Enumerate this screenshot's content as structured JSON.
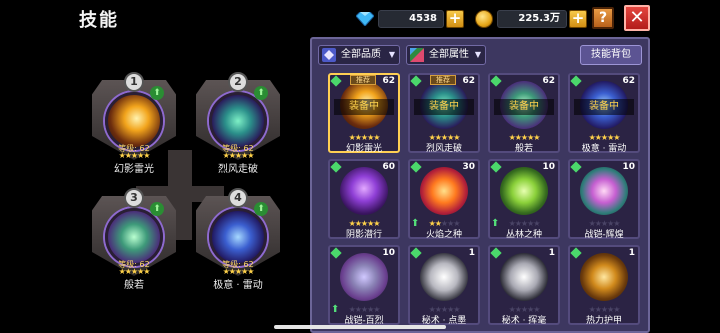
{
  "header": {
    "title": "技能"
  },
  "currency": {
    "gems": {
      "value": "4538",
      "icon": "diamond-icon"
    },
    "coins": {
      "value": "225.3万",
      "icon": "coin-icon"
    }
  },
  "buttons": {
    "help": "?",
    "close": "✕",
    "plus": "+"
  },
  "equipped": [
    {
      "slot": "1",
      "level": "等级: 62",
      "stars": "★★★★★",
      "name": "幻影雷光",
      "icon": "phantom-thunder-icon"
    },
    {
      "slot": "2",
      "level": "等级: 62",
      "stars": "★★★★★",
      "name": "烈风走破",
      "icon": "gale-break-icon"
    },
    {
      "slot": "3",
      "level": "等级: 62",
      "stars": "★★★★★",
      "name": "般若",
      "icon": "prajna-icon"
    },
    {
      "slot": "4",
      "level": "等级: 62",
      "stars": "★★★★★",
      "name": "极意 · 雷动",
      "icon": "ultimate-thunder-icon"
    }
  ],
  "panel": {
    "filter_quality": "全部品质",
    "filter_attribute": "全部属性",
    "skill_bag": "技能背包"
  },
  "cards": [
    {
      "name": "幻影雷光",
      "count": "62",
      "tag": "推荐",
      "status": "装备中",
      "stars_on": "★★★★★",
      "stars_off": "",
      "upgrade": "",
      "selected": true
    },
    {
      "name": "烈风走破",
      "count": "62",
      "tag": "推荐",
      "status": "装备中",
      "stars_on": "★★★★★",
      "stars_off": "",
      "upgrade": "",
      "selected": false
    },
    {
      "name": "般若",
      "count": "62",
      "tag": "",
      "status": "装备中",
      "stars_on": "★★★★★",
      "stars_off": "",
      "upgrade": "",
      "selected": false
    },
    {
      "name": "极意 · 雷动",
      "count": "62",
      "tag": "",
      "status": "装备中",
      "stars_on": "★★★★★",
      "stars_off": "",
      "upgrade": "",
      "selected": false
    },
    {
      "name": "阴影潜行",
      "count": "60",
      "tag": "",
      "status": "",
      "stars_on": "★★★★★",
      "stars_off": "",
      "upgrade": "",
      "selected": false
    },
    {
      "name": "火焰之种",
      "count": "30",
      "tag": "",
      "status": "",
      "stars_on": "★★",
      "stars_off": "★★★",
      "upgrade": "⬆",
      "selected": false
    },
    {
      "name": "丛林之种",
      "count": "10",
      "tag": "",
      "status": "",
      "stars_on": "",
      "stars_off": "★★★★★",
      "upgrade": "⬆",
      "selected": false
    },
    {
      "name": "战铠-辉煌",
      "count": "10",
      "tag": "",
      "status": "",
      "stars_on": "",
      "stars_off": "★★★★★",
      "upgrade": "",
      "selected": false
    },
    {
      "name": "战铠-百烈",
      "count": "10",
      "tag": "",
      "status": "",
      "stars_on": "",
      "stars_off": "★★★★★",
      "upgrade": "⬆",
      "selected": false
    },
    {
      "name": "秘术 · 点墨",
      "count": "1",
      "tag": "",
      "status": "",
      "stars_on": "",
      "stars_off": "★★★★★",
      "upgrade": "",
      "selected": false
    },
    {
      "name": "秘术 · 挥毫",
      "count": "1",
      "tag": "",
      "status": "",
      "stars_on": "",
      "stars_off": "★★★★★",
      "upgrade": "",
      "selected": false
    },
    {
      "name": "热力护甲",
      "count": "1",
      "tag": "",
      "status": "",
      "stars_on": "",
      "stars_off": "★★★★★",
      "upgrade": "",
      "selected": false
    }
  ],
  "colors": {
    "panel_bg": "#3d3760",
    "card_bg": "#2b2344",
    "star": "#ffd24a",
    "equipped_text": "#ffd34e"
  }
}
